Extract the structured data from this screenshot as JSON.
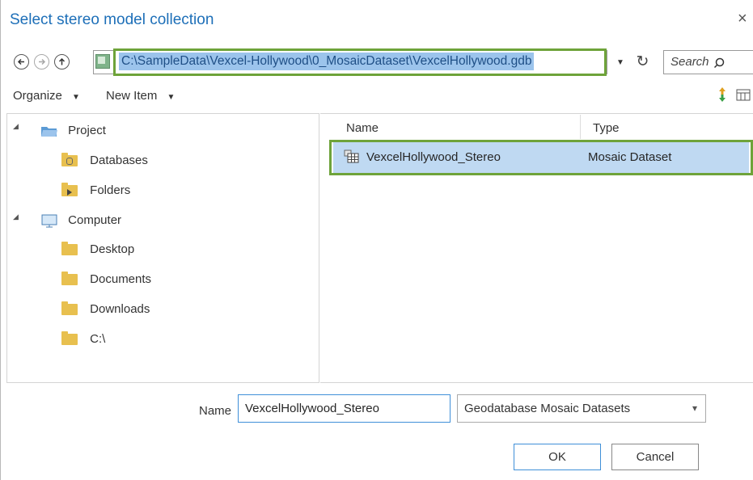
{
  "dialog": {
    "title": "Select stereo model collection",
    "close_glyph": "×"
  },
  "nav": {
    "back_icon": "back-arrow-icon",
    "forward_icon": "forward-arrow-icon",
    "up_icon": "up-arrow-icon",
    "address_path": "C:\\SampleData\\Vexcel-Hollywood\\0_MosaicDataset\\VexcelHollywood.gdb",
    "dropdown_glyph": "▼",
    "refresh_glyph": "↻",
    "search_placeholder": "Search",
    "search_icon_glyph": "⚲"
  },
  "toolbar": {
    "organize_label": "Organize",
    "new_item_label": "New Item",
    "caret": "▼"
  },
  "tree": {
    "expand_glyph": "◢",
    "items": [
      {
        "label": "Project",
        "icon": "project-icon"
      },
      {
        "label": "Databases",
        "icon": "databases-folder-icon"
      },
      {
        "label": "Folders",
        "icon": "folders-icon"
      },
      {
        "label": "Computer",
        "icon": "computer-icon"
      },
      {
        "label": "Desktop",
        "icon": "folder-icon"
      },
      {
        "label": "Documents",
        "icon": "folder-icon"
      },
      {
        "label": "Downloads",
        "icon": "folder-icon"
      },
      {
        "label": "C:\\",
        "icon": "folder-icon"
      }
    ]
  },
  "list": {
    "columns": [
      "Name",
      "Type"
    ],
    "rows": [
      {
        "name": "VexcelHollywood_Stereo",
        "type": "Mosaic Dataset",
        "selected": true
      }
    ]
  },
  "footer": {
    "name_label": "Name",
    "name_value": "VexcelHollywood_Stereo",
    "filter_value": "Geodatabase Mosaic Datasets",
    "filter_caret": "▾",
    "ok_label": "OK",
    "cancel_label": "Cancel"
  },
  "colors": {
    "highlight_border": "#6ea33a",
    "selection_fill": "#bfd9f2",
    "title_blue": "#1d6fb8"
  }
}
